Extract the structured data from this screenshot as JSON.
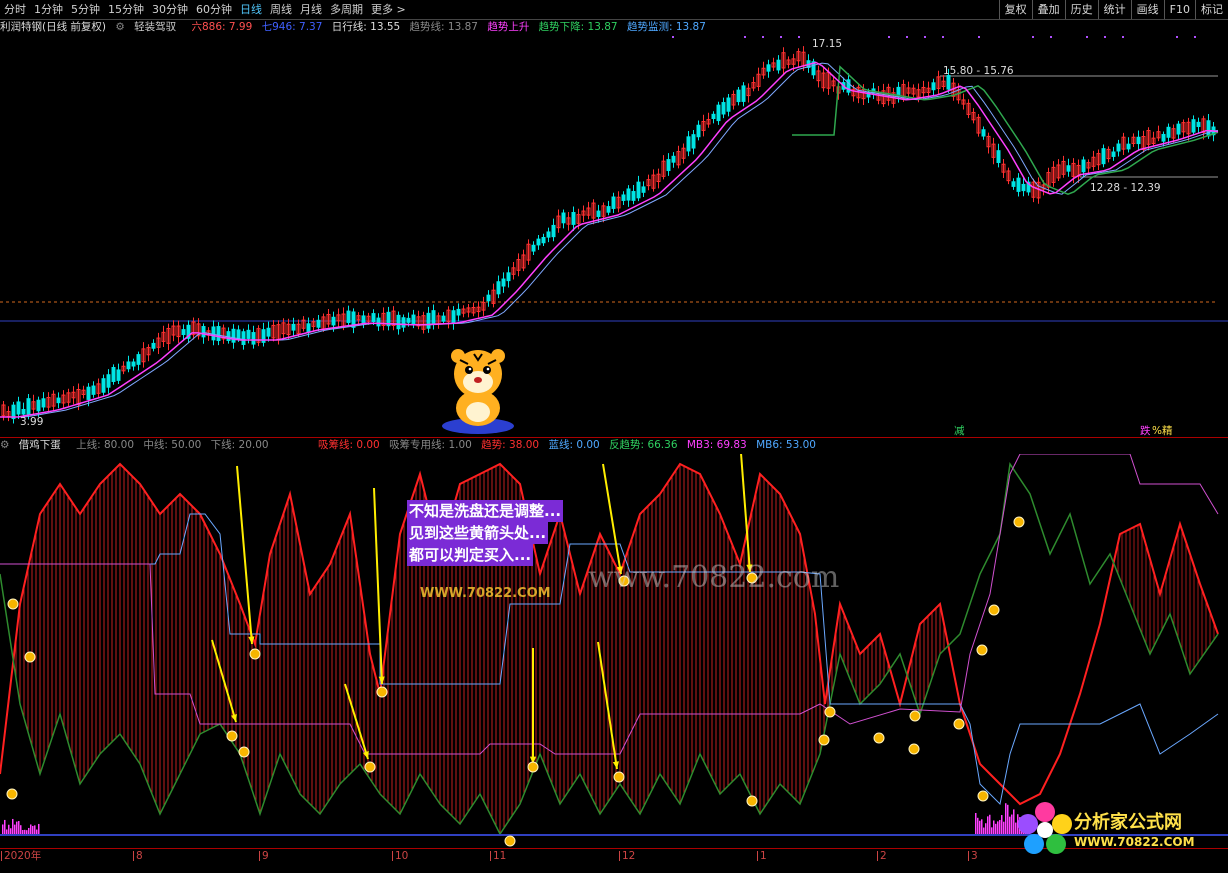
{
  "toolbar": {
    "periods": [
      "分时",
      "1分钟",
      "5分钟",
      "15分钟",
      "30分钟",
      "60分钟",
      "日线",
      "周线",
      "月线",
      "多周期",
      "更多 >"
    ],
    "active_period": "日线",
    "right_buttons": [
      "复权",
      "叠加",
      "历史",
      "统计",
      "画线",
      "F10",
      "标记"
    ]
  },
  "main_info": {
    "stock": "利润特钢(日线 前复权)",
    "icon_label": "轻装驾驭",
    "ma6": "六886: 7.99",
    "ma7": "七946: 7.37",
    "daily_line": "日行线: 13.55",
    "trend_line": "趋势线: 13.87",
    "trend_up": "趋势上升",
    "trend_down": "趋势下降: 13.87",
    "trend_monitor": "趋势监测: 13.87"
  },
  "price_labels": {
    "high": "17.15",
    "resistance": "15.80 - 15.76",
    "support": "12.28 - 12.39",
    "low": "3.99",
    "sign_reduce": "减",
    "sign_fall": "跌",
    "sign_tag": "%精"
  },
  "sub_info": {
    "name": "借鸡下蛋",
    "upper": "上线: 80.00",
    "middle": "中线: 50.00",
    "lower": "下线: 20.00",
    "absorb": "吸筹线: 0.00",
    "absorb_special": "吸筹专用线: 1.00",
    "trend": "趋势: 38.00",
    "blue": "蓝线: 0.00",
    "anti_trend": "反趋势: 66.36",
    "mb3": "MB3: 69.83",
    "mb6": "MB6: 53.00"
  },
  "note": {
    "line1": "不知是洗盘还是调整...",
    "line2": "见到这些黄箭头处...",
    "line3": "都可以判定买入..."
  },
  "watermark": "www.70822.com",
  "watermark2": "WWW.70822.COM",
  "logo": {
    "title": "分析家公式网",
    "url": "WWW.70822.COM"
  },
  "dates": [
    "2020年",
    "8",
    "9",
    "10",
    "11",
    "12",
    "1",
    "2",
    "3"
  ],
  "colors": {
    "up": "#ff3030",
    "down": "#00e5e5",
    "ma_fast": "#ff40ff",
    "ma_slow": "#7fa8ff",
    "ma_green": "#2fa84f",
    "arrow": "#ffee00",
    "dot": "#f7b500"
  }
}
